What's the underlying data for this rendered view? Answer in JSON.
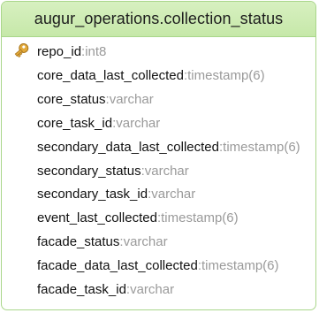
{
  "table": {
    "title": "augur_operations.collection_status",
    "colors": {
      "border": "#a9d68a",
      "header_fill": "#c6e8a9",
      "field_name": "#111111",
      "field_type": "#9a9a9a",
      "key_icon": "#e2a93a"
    },
    "fields": [
      {
        "name": "repo_id",
        "sep": ": ",
        "type": "int8",
        "icon": "key-icon",
        "primary_key": true
      },
      {
        "name": "core_data_last_collected",
        "sep": ": ",
        "type": "timestamp(6)"
      },
      {
        "name": "core_status",
        "sep": ": ",
        "type": "varchar"
      },
      {
        "name": "core_task_id",
        "sep": ": ",
        "type": "varchar"
      },
      {
        "name": "secondary_data_last_collected",
        "sep": ": ",
        "type": "timestamp(6)"
      },
      {
        "name": "secondary_status",
        "sep": ": ",
        "type": "varchar"
      },
      {
        "name": "secondary_task_id",
        "sep": ": ",
        "type": "varchar"
      },
      {
        "name": "event_last_collected",
        "sep": ": ",
        "type": "timestamp(6)"
      },
      {
        "name": "facade_status",
        "sep": ": ",
        "type": "varchar"
      },
      {
        "name": "facade_data_last_collected",
        "sep": ": ",
        "type": "timestamp(6)"
      },
      {
        "name": "facade_task_id",
        "sep": ": ",
        "type": "varchar"
      }
    ]
  }
}
